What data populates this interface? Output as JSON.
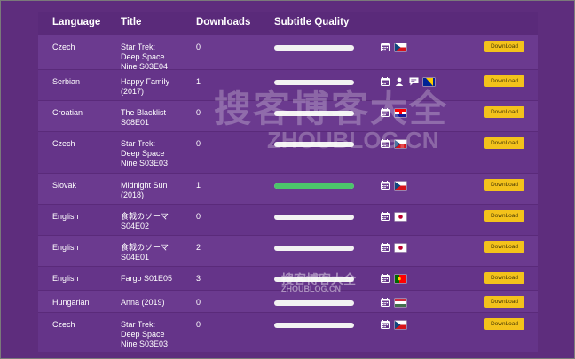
{
  "table": {
    "headers": {
      "language": "Language",
      "title": "Title",
      "downloads": "Downloads",
      "quality": "Subtitle Quality"
    },
    "rows": [
      {
        "language": "Czech",
        "title": [
          "Star Trek:",
          "Deep Space",
          "Nine S03E04"
        ],
        "downloads": "0",
        "quality": 0,
        "icons": [
          "calendar-icon"
        ],
        "flag": "cz",
        "button": "DownLoad"
      },
      {
        "language": "Serbian",
        "title": [
          "Happy Family",
          "(2017)"
        ],
        "downloads": "1",
        "quality": 0,
        "icons": [
          "calendar-icon",
          "user-icon",
          "comment-icon"
        ],
        "flag": "ba",
        "button": "DownLoad"
      },
      {
        "language": "Croatian",
        "title": [
          "The Blacklist",
          "S08E01"
        ],
        "downloads": "0",
        "quality": 0,
        "icons": [
          "calendar-icon"
        ],
        "flag": "hr",
        "button": "DownLoad"
      },
      {
        "language": "Czech",
        "title": [
          "Star Trek:",
          "Deep Space",
          "Nine S03E03"
        ],
        "downloads": "0",
        "quality": 0,
        "icons": [
          "calendar-icon"
        ],
        "flag": "cz",
        "button": "DownLoad"
      },
      {
        "language": "Slovak",
        "title": [
          "Midnight Sun",
          "(2018)"
        ],
        "downloads": "1",
        "quality": 100,
        "icons": [
          "calendar-icon"
        ],
        "flag": "cz",
        "button": "DownLoad"
      },
      {
        "language": "English",
        "title": [
          "食戟のソーマ",
          "S04E02"
        ],
        "downloads": "0",
        "quality": 0,
        "icons": [
          "calendar-icon"
        ],
        "flag": "jp",
        "button": "DownLoad"
      },
      {
        "language": "English",
        "title": [
          "食戟のソーマ",
          "S04E01"
        ],
        "downloads": "2",
        "quality": 0,
        "icons": [
          "calendar-icon"
        ],
        "flag": "jp",
        "button": "DownLoad"
      },
      {
        "language": "English",
        "title": [
          "Fargo S01E05"
        ],
        "downloads": "3",
        "quality": 0,
        "icons": [
          "calendar-icon"
        ],
        "flag": "pt",
        "button": "DownLoad"
      },
      {
        "language": "Hungarian",
        "title": [
          "Anna (2019)"
        ],
        "downloads": "0",
        "quality": 0,
        "icons": [
          "calendar-icon"
        ],
        "flag": "hu",
        "button": "DownLoad"
      },
      {
        "language": "Czech",
        "title": [
          "Star Trek:",
          "Deep Space",
          "Nine S03E03"
        ],
        "downloads": "0",
        "quality": 0,
        "icons": [
          "calendar-icon"
        ],
        "flag": "cz",
        "button": "DownLoad"
      }
    ]
  },
  "watermark": {
    "main": "搜客博客大全",
    "main_url": "ZHOUBLOG.CN",
    "small": "搜客博客大全",
    "small_url": "ZHOUBLOG.CN"
  },
  "colors": {
    "background": "#5e2d7d",
    "row": "#6b3a8f",
    "button": "#f3c21b",
    "quality_fill": "#4cc56b"
  }
}
